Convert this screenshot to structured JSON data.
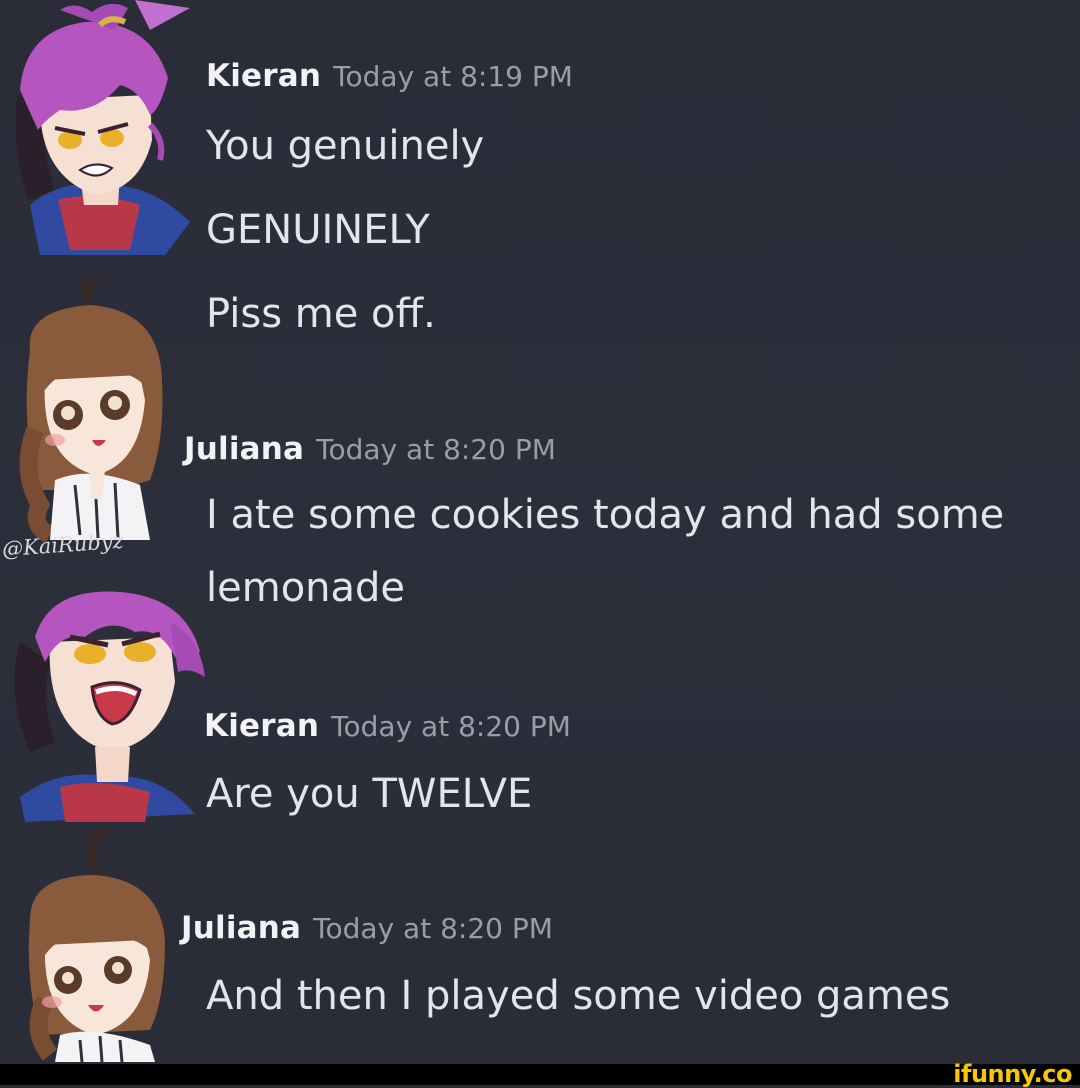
{
  "messages": [
    {
      "username": "Kieran",
      "timestamp": "Today at 8:19 PM",
      "avatar": "kieran-angry-avatar",
      "lines": [
        "You genuinely",
        "GENUINELY",
        "Piss me off."
      ]
    },
    {
      "username": "Juliana",
      "timestamp": "Today at 8:20 PM",
      "avatar": "juliana-happy-avatar",
      "lines": [
        "I ate some cookies today and had some",
        "lemonade"
      ]
    },
    {
      "username": "Kieran",
      "timestamp": "Today at 8:20 PM",
      "avatar": "kieran-yelling-avatar",
      "lines": [
        "Are you TWELVE"
      ]
    },
    {
      "username": "Juliana",
      "timestamp": "Today at 8:20 PM",
      "avatar": "juliana-smiling-avatar",
      "lines": [
        "And then I played some video games"
      ]
    }
  ],
  "watermark": "@KaiRubyz",
  "footer": {
    "brand": "ifunny.co"
  },
  "colors": {
    "background": "#2b2d3a",
    "username": "#f2f3f5",
    "timestamp": "#9a9ca8",
    "message_text": "#e4e5ea",
    "brand": "#f7c700"
  }
}
